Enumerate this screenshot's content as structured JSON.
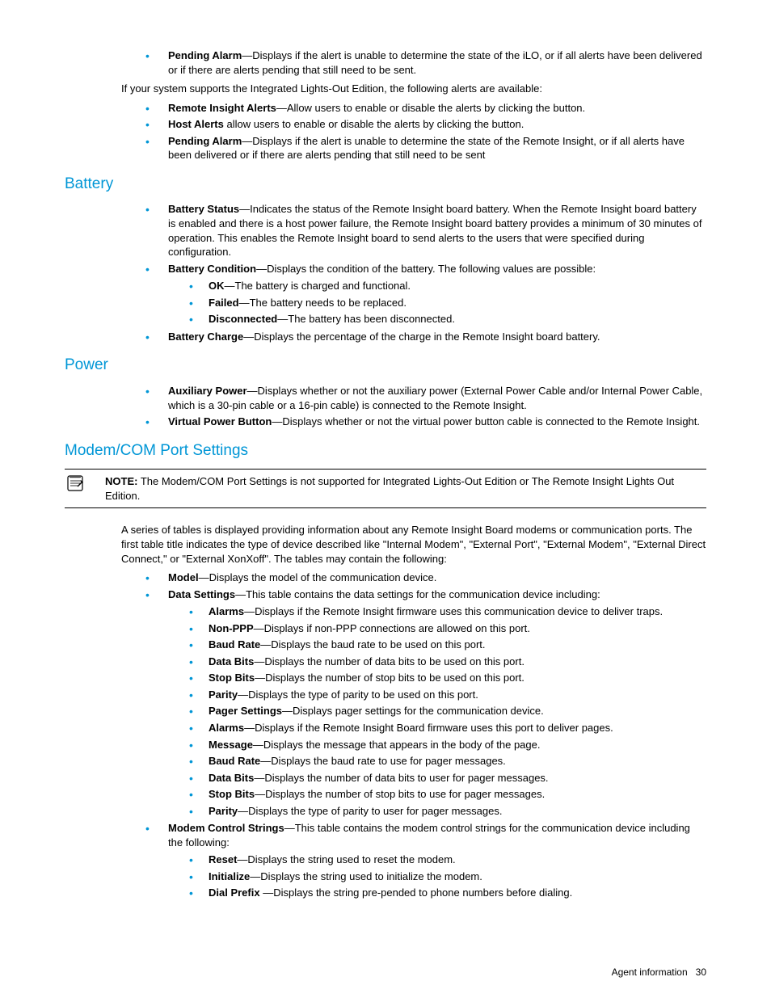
{
  "intro": {
    "pendingAlarm": {
      "term": "Pending Alarm",
      "desc": "—Displays if the alert is unable to determine the state of the iLO, or if all alerts have been delivered or if there are alerts pending that still need to be sent."
    },
    "supportsText": "If your system supports the Integrated Lights-Out Edition, the following alerts are available:",
    "remoteInsightAlerts": {
      "term": "Remote Insight Alerts",
      "desc": "—Allow users to enable or disable the alerts by clicking the button."
    },
    "hostAlerts": {
      "term": "Host Alerts",
      "desc": " allow users to enable or disable the alerts by clicking the button."
    },
    "pendingAlarm2": {
      "term": "Pending Alarm",
      "desc": "—Displays if the alert is unable to determine the state of the Remote Insight, or if all alerts have been delivered or if there are alerts pending that still need to be sent"
    }
  },
  "battery": {
    "heading": "Battery",
    "status": {
      "term": "Battery Status",
      "desc": "—Indicates the status of the Remote Insight board battery. When the Remote Insight board battery is enabled and there is a host power failure, the Remote Insight board battery provides a minimum of 30 minutes of operation. This enables the Remote Insight board to send alerts to the users that were specified during configuration."
    },
    "condition": {
      "term": "Battery Condition",
      "desc": "—Displays the condition of the battery. The following values are possible:"
    },
    "ok": {
      "term": "OK",
      "desc": "—The battery is charged and functional."
    },
    "failed": {
      "term": "Failed",
      "desc": "—The battery needs to be replaced."
    },
    "disconnected": {
      "term": "Disconnected",
      "desc": "—The battery has been disconnected."
    },
    "charge": {
      "term": "Battery Charge",
      "desc": "—Displays the percentage of the charge in the Remote Insight board battery."
    }
  },
  "power": {
    "heading": "Power",
    "aux": {
      "term": "Auxiliary Power",
      "desc": "—Displays whether or not the auxiliary power  (External Power Cable and/or Internal Power Cable, which is a 30-pin cable or a 16-pin cable) is connected to the Remote Insight."
    },
    "vpb": {
      "term": "Virtual Power Button",
      "desc": "—Displays whether or not the virtual power button cable is connected to the Remote Insight."
    }
  },
  "modem": {
    "heading": "Modem/COM Port Settings",
    "noteLabel": "NOTE:",
    "noteText": "  The Modem/COM Port Settings is not supported for Integrated Lights-Out Edition or The Remote Insight Lights Out Edition.",
    "para": "A series of tables is displayed providing information about any Remote Insight Board modems or communication ports. The first table title indicates the type of device described like \"Internal Modem\", \"External Port\", \"External Modem\", \"External Direct Connect,\" or \"External XonXoff\". The tables may contain the following:",
    "model": {
      "term": "Model",
      "desc": "—Displays the model of the communication device."
    },
    "dataSettings": {
      "term": "Data Settings",
      "desc": "—This table contains the data settings for the communication device including:"
    },
    "alarms1": {
      "term": "Alarms",
      "desc": "—Displays if the Remote Insight firmware uses this communication device to deliver traps."
    },
    "nonppp": {
      "term": "Non-PPP",
      "desc": "—Displays if non-PPP connections are allowed on this port."
    },
    "baud1": {
      "term": "Baud Rate",
      "desc": "—Displays the baud rate to be used on this port."
    },
    "databits1": {
      "term": "Data Bits",
      "desc": "—Displays the number of data bits to be used on this port."
    },
    "stopbits1": {
      "term": "Stop Bits",
      "desc": "—Displays the number of stop bits to be used on this port."
    },
    "parity1": {
      "term": "Parity",
      "desc": "—Displays the type of parity to be used on this port."
    },
    "pager": {
      "term": "Pager Settings",
      "desc": "—Displays pager settings for the communication device."
    },
    "alarms2": {
      "term": "Alarms",
      "desc": "—Displays if the Remote Insight Board firmware uses this port to deliver pages."
    },
    "message": {
      "term": "Message",
      "desc": "—Displays the message that appears in the body of the page."
    },
    "baud2": {
      "term": "Baud Rate",
      "desc": "—Displays the baud rate to use for pager messages."
    },
    "databits2": {
      "term": "Data Bits",
      "desc": "—Displays the number of data bits to user for pager messages."
    },
    "stopbits2": {
      "term": "Stop Bits",
      "desc": "—Displays the number of stop bits to use for pager messages."
    },
    "parity2": {
      "term": "Parity",
      "desc": "—Displays the type of parity to user for pager messages."
    },
    "mcs": {
      "term": "Modem Control Strings",
      "desc": "—This table contains the modem control strings for the communication device including the following:"
    },
    "reset": {
      "term": "Reset",
      "desc": "—Displays the string used to reset the modem."
    },
    "init": {
      "term": "Initialize",
      "desc": "—Displays the string used to initialize the modem."
    },
    "dial": {
      "term": "Dial Prefix ",
      "desc": "—Displays the string pre-pended to phone numbers before dialing."
    }
  },
  "footer": {
    "section": "Agent information",
    "page": "30"
  }
}
